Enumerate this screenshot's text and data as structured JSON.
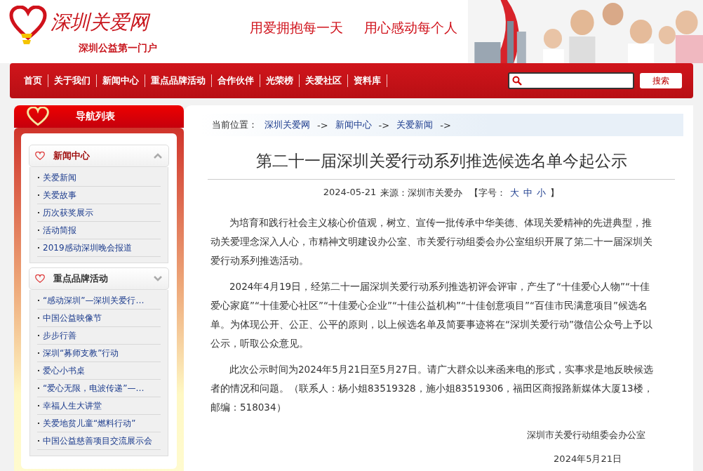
{
  "header": {
    "logo_text": "深圳关爱网",
    "tagline": "深圳公益第一门户",
    "slogans": [
      "用爱拥抱每一天",
      "用心感动每个人"
    ]
  },
  "nav": {
    "items": [
      {
        "label": "首页"
      },
      {
        "label": "关于我们"
      },
      {
        "label": "新闻中心"
      },
      {
        "label": "重点品牌活动"
      },
      {
        "label": "合作伙伴"
      },
      {
        "label": "光荣榜"
      },
      {
        "label": "关爱社区"
      },
      {
        "label": "资料库"
      }
    ],
    "search_button": "搜索"
  },
  "sidebar": {
    "title": "导航列表",
    "groups": [
      {
        "title": "新闻中心",
        "selected": true,
        "items": [
          "关爱新闻",
          "关爱故事",
          "历次获奖展示",
          "活动简报",
          "2019感动深圳晚会报道"
        ]
      },
      {
        "title": "重点品牌活动",
        "selected": false,
        "items": [
          "“感动深圳”—深圳关爱行…",
          "中国公益映像节",
          "步步行善",
          "深圳“募师支教”行动",
          "爱心小书桌",
          "“爱心无限，电波传递”—…",
          "幸福人生大讲堂",
          "关爱地贫儿童“燃料行动”",
          "中国公益慈善项目交流展示会"
        ]
      }
    ]
  },
  "breadcrumb": {
    "label": "当前位置：",
    "items": [
      "深圳关爱网",
      "新闻中心",
      "关爱新闻"
    ],
    "separator": "->"
  },
  "article": {
    "title": "第二十一届深圳关爱行动系列推选候选名单今起公示",
    "date": "2024-05-21",
    "source": "来源：深圳市关爱办",
    "font_size_label": "【字号：",
    "font_sizes": [
      "大",
      "中",
      "小"
    ],
    "font_size_close": "】",
    "paragraphs": [
      "为培育和践行社会主义核心价值观，树立、宣传一批传承中华美德、体现关爱精神的先进典型，推动关爱理念深入人心，市精神文明建设办公室、市关爱行动组委会办公室组织开展了第二十一届深圳关爱行动系列推选活动。",
      "2024年4月19日，经第二十一届深圳关爱行动系列推选初评会评审，产生了“十佳爱心人物”“十佳爱心家庭”“十佳爱心社区”“十佳爱心企业”“十佳公益机构”“十佳创意项目”“百佳市民满意项目”候选名单。为体现公开、公正、公平的原则，以上候选名单及简要事迹将在“深圳关爱行动”微信公众号上予以公示，听取公众意见。",
      "此次公示时间为2024年5月21日至5月27日。请广大群众以来函来电的形式，实事求是地反映候选者的情况和问题。（联系人：杨小姐83519328，施小姐83519306，福田区商报路新媒体大厦13楼，邮编：518034）"
    ],
    "signature": "深圳市关爱行动组委会办公室",
    "signed_date": "2024年5月21日"
  }
}
